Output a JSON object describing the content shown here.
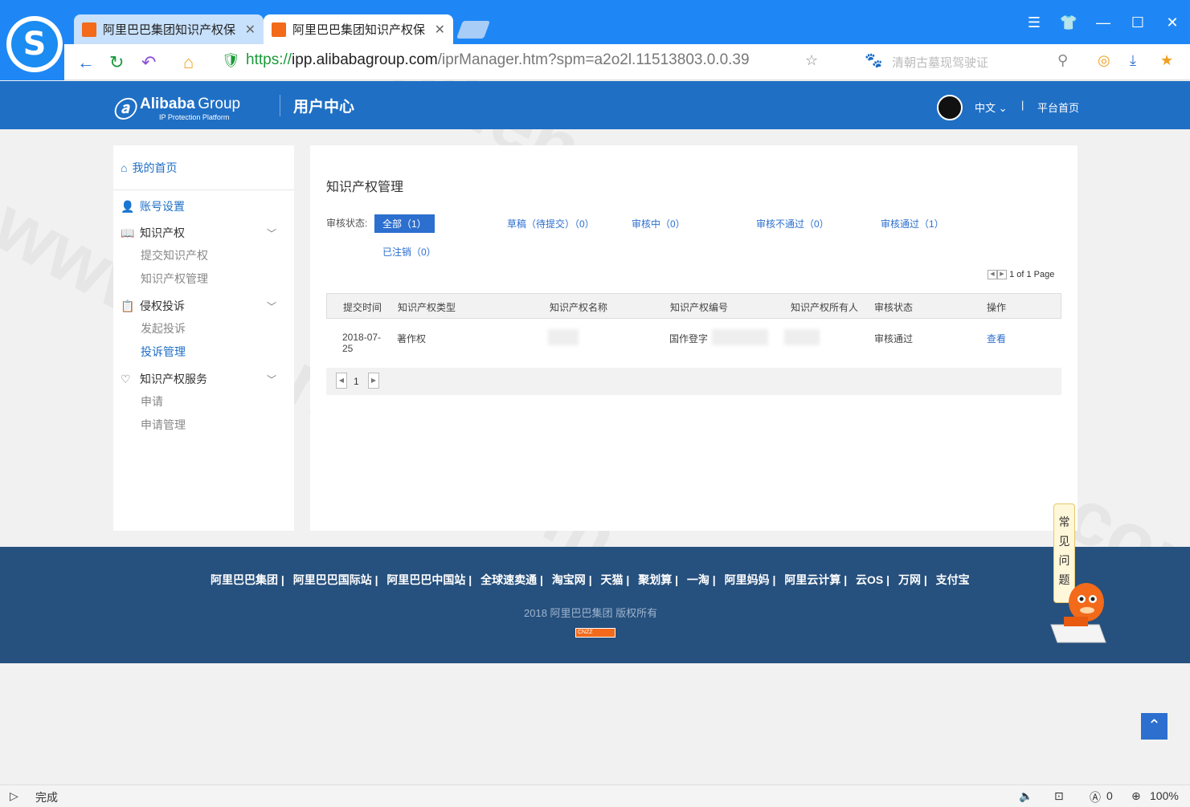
{
  "browser": {
    "tabs": [
      {
        "title": "阿里巴巴集团知识产权保",
        "close": "✕"
      },
      {
        "title": "阿里巴巴集团知识产权保",
        "close": "✕"
      }
    ],
    "url_https": "https://",
    "url_host": "ipp.alibabagroup.com",
    "url_path": "/iprManager.htm?spm=a2o2l.11513803.0.0.39",
    "search_placeholder": "清朝古墓现驾驶证",
    "status_text": "完成",
    "zoom": "100%",
    "adblock_count": "0"
  },
  "header": {
    "brand_mark": "Alibaba",
    "brand_name": "Group",
    "brand_sub": "IP Protection Platform",
    "section": "用户中心",
    "language": "中文",
    "separator": "|",
    "platform_home": "平台首页"
  },
  "sidebar": {
    "home": "我的首页",
    "account": "账号设置",
    "ip": "知识产权",
    "ip_submit": "提交知识产权",
    "ip_manage": "知识产权管理",
    "complaint": "侵权投诉",
    "complaint_start": "发起投诉",
    "complaint_manage": "投诉管理",
    "service": "知识产权服务",
    "service_apply": "申请",
    "service_manage": "申请管理"
  },
  "main": {
    "title": "知识产权管理",
    "filter_label": "审核状态:",
    "filters": {
      "all": "全部（1）",
      "draft": "草稿（待提交）（0）",
      "reviewing": "审核中（0）",
      "rejected": "审核不通过（0）",
      "approved": "审核通过（1）",
      "cancelled": "已注销（0）"
    },
    "pager_text": "1 of 1 Page",
    "columns": [
      "提交时间",
      "知识产权类型",
      "知识产权名称",
      "知识产权编号",
      "知识产权所有人",
      "审核状态",
      "操作"
    ],
    "row": {
      "date": "2018-07-25",
      "type": "著作权",
      "number_prefix": "国作登字",
      "status": "审核通过",
      "action": "查看"
    },
    "page_number": "1"
  },
  "footer": {
    "links": [
      "阿里巴巴集团 |",
      "阿里巴巴国际站 |",
      "阿里巴巴中国站 |",
      "全球速卖通 |",
      "淘宝网 |",
      "天猫 |",
      "聚划算 |",
      "一淘 |",
      "阿里妈妈 |",
      "阿里云计算 |",
      "云OS |",
      "万网 |",
      "支付宝"
    ],
    "copyright": "2018 阿里巴巴集团 版权所有",
    "cnzz": "CNZZ"
  },
  "widgets": {
    "faq": [
      "常",
      "见",
      "问",
      "题"
    ]
  },
  "watermark": "www.shensu8.com",
  "colors": {
    "accent": "#1f6fc5",
    "browser": "#1f87f5",
    "footer": "#26507d"
  }
}
